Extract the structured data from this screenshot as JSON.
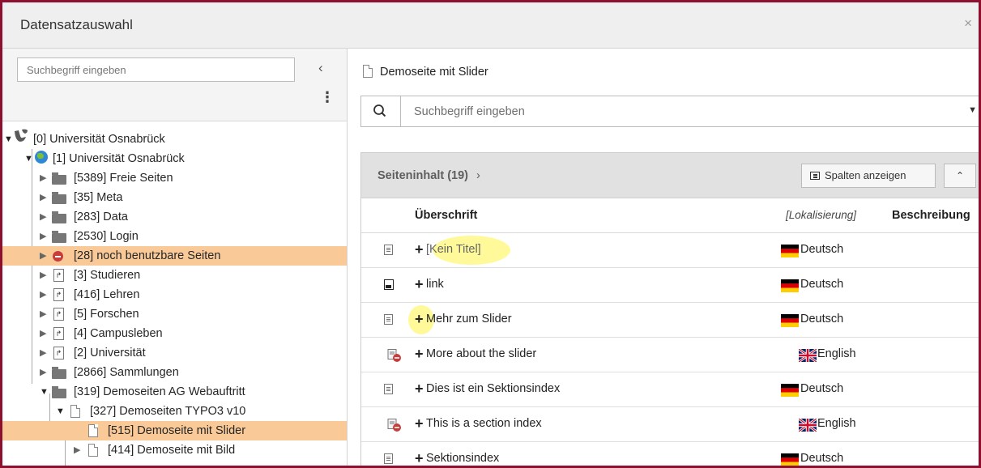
{
  "modal": {
    "title": "Datensatzauswahl",
    "close_glyph": "×"
  },
  "tree_panel": {
    "search_placeholder": "Suchbegriff eingeben",
    "collapse_glyph": "‹",
    "menu_glyph": "⋮",
    "nodes": [
      {
        "label": "[0] Universität Osnabrück",
        "icon": "typo3-logo-icon",
        "expanded": true
      },
      {
        "label": "[1] Universität Osnabrück",
        "icon": "globe-icon",
        "expanded": true
      },
      {
        "label": "[5389] Freie Seiten",
        "icon": "folder-icon"
      },
      {
        "label": "[35] Meta",
        "icon": "folder-icon"
      },
      {
        "label": "[283] Data",
        "icon": "folder-icon"
      },
      {
        "label": "[2530] Login",
        "icon": "folder-icon"
      },
      {
        "label": "[28] noch benutzbare Seiten",
        "icon": "no-access-icon",
        "highlighted": true
      },
      {
        "label": "[3] Studieren",
        "icon": "shortcut-page-icon"
      },
      {
        "label": "[416] Lehren",
        "icon": "shortcut-page-icon"
      },
      {
        "label": "[5] Forschen",
        "icon": "shortcut-page-icon"
      },
      {
        "label": "[4] Campusleben",
        "icon": "shortcut-page-icon"
      },
      {
        "label": "[2] Universität",
        "icon": "shortcut-page-icon"
      },
      {
        "label": "[2866] Sammlungen",
        "icon": "folder-icon"
      },
      {
        "label": "[319] Demoseiten AG Webauftritt",
        "icon": "folder-icon",
        "expanded": true
      },
      {
        "label": "[327] Demoseiten TYPO3 v10",
        "icon": "page-icon",
        "expanded": true
      },
      {
        "label": "[515] Demoseite mit Slider",
        "icon": "page-icon",
        "highlighted": true,
        "selected": true
      },
      {
        "label": "[414] Demoseite mit Bild",
        "icon": "page-icon"
      }
    ]
  },
  "content_panel": {
    "page_title": "Demoseite mit Slider",
    "search_placeholder": "Suchbegriff eingeben",
    "section_title": "Seiteninhalt (19)",
    "section_chevron": "›",
    "columns_button": "Spalten anzeigen",
    "collapse_glyph": "⌃",
    "headers": {
      "title": "Überschrift",
      "localization": "[Lokalisierung]",
      "description": "Beschreibung"
    },
    "rows": [
      {
        "title": "[Kein Titel]",
        "language": "Deutsch",
        "icon": "text-content-icon",
        "muted": true
      },
      {
        "title": "link",
        "language": "Deutsch",
        "icon": "image-content-icon"
      },
      {
        "title": "Mehr zum Slider",
        "language": "Deutsch",
        "icon": "text-content-icon"
      },
      {
        "title": "More about the slider",
        "language": "English",
        "icon": "hidden-content-icon"
      },
      {
        "title": "Dies ist ein Sektionsindex",
        "language": "Deutsch",
        "icon": "text-content-icon"
      },
      {
        "title": "This is a section index",
        "language": "English",
        "icon": "hidden-content-icon"
      },
      {
        "title": "Sektionsindex",
        "language": "Deutsch",
        "icon": "menu-content-icon"
      }
    ],
    "plus_glyph": "+"
  },
  "colors": {
    "modal_border": "#8e0f2e",
    "tree_highlight": "#f9c998",
    "panel_header": "#e1e1e1"
  }
}
